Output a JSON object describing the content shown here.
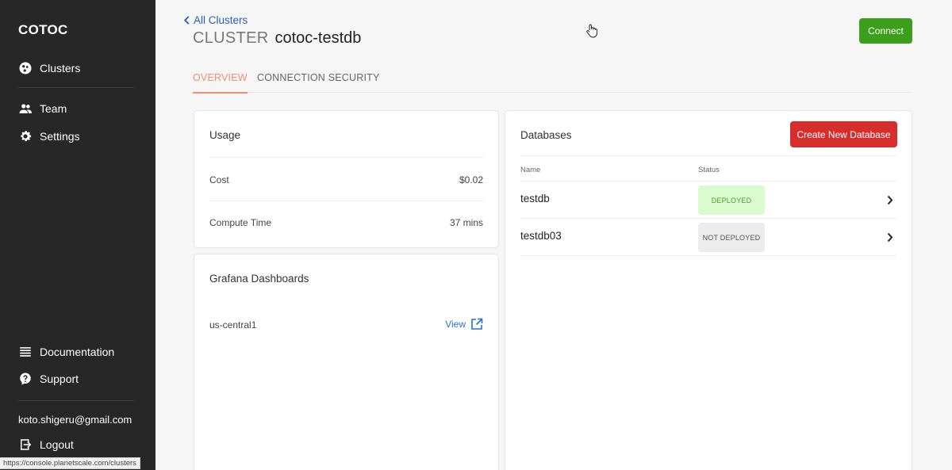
{
  "sidebar": {
    "brand": "COTOC",
    "nav": {
      "clusters": "Clusters",
      "team": "Team",
      "settings": "Settings",
      "documentation": "Documentation",
      "support": "Support",
      "logout": "Logout"
    },
    "user_email": "koto.shigeru@gmail.com"
  },
  "status_bar_url": "https://console.planetscale.com/clusters",
  "header": {
    "back_link": "All Clusters",
    "title_prefix": "CLUSTER",
    "cluster_name": "cotoc-testdb",
    "connect_label": "Connect"
  },
  "tabs": {
    "overview": "OVERVIEW",
    "security": "CONNECTION SECURITY"
  },
  "usage": {
    "title": "Usage",
    "rows": [
      {
        "label": "Cost",
        "value": "$0.02"
      },
      {
        "label": "Compute Time",
        "value": "37 mins"
      }
    ]
  },
  "grafana": {
    "title": "Grafana Dashboards",
    "region": "us-central1",
    "view_label": "View"
  },
  "databases": {
    "title": "Databases",
    "create_label": "Create New Database",
    "col_name": "Name",
    "col_status": "Status",
    "rows": [
      {
        "name": "testdb",
        "status": "DEPLOYED"
      },
      {
        "name": "testdb03",
        "status": "NOT DEPLOYED"
      }
    ]
  },
  "colors": {
    "sidebar_bg": "#272727",
    "connect_green": "#3c9f1b",
    "create_red": "#d62d2d",
    "tab_active": "#f08e6f",
    "link_blue": "#2a61b8",
    "deployed_bg": "#d9fbcd",
    "not_deployed_bg": "#ececec"
  },
  "icons": {
    "clusters": "globe-icon",
    "team": "people-icon",
    "settings": "gear-icon",
    "documentation": "list-icon",
    "support": "question-icon",
    "logout": "logout-icon"
  }
}
